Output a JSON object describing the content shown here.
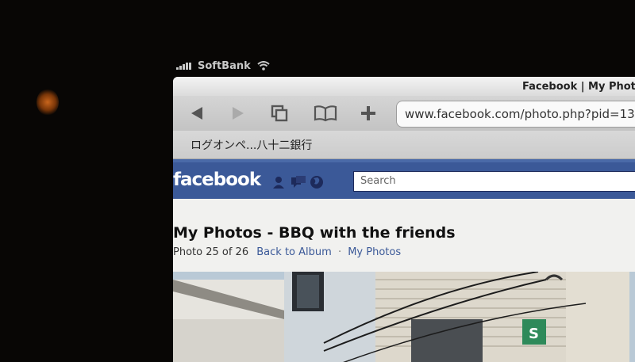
{
  "status_bar": {
    "carrier": "SoftBank"
  },
  "browser": {
    "page_title": "Facebook | My Photo",
    "url": "www.facebook.com/photo.php?pid=13",
    "bookmark": "ログオンペ...八十二銀行",
    "toolbar_icons": [
      "back-arrow-icon",
      "forward-arrow-icon",
      "pages-icon",
      "bookmarks-book-icon",
      "add-plus-icon"
    ]
  },
  "facebook": {
    "logo": "facebook",
    "search_placeholder": "Search",
    "brand_color": "#3b5998",
    "header_icons": [
      "friend-requests-icon",
      "messages-icon",
      "notifications-globe-icon"
    ]
  },
  "album": {
    "title": "My Photos - BBQ with the friends",
    "photo_counter": "Photo 25 of 26",
    "back_link": "Back to Album",
    "separator": "·",
    "my_photos_link": "My Photos"
  }
}
